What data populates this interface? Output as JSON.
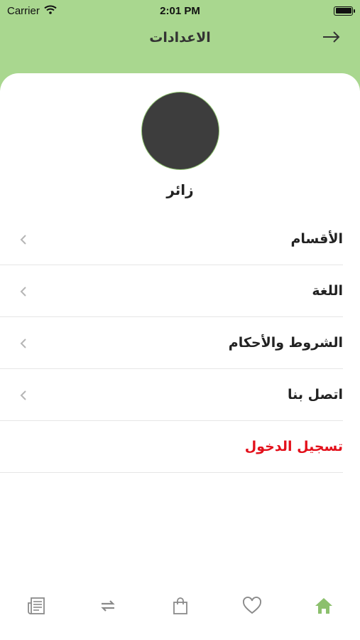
{
  "status_bar": {
    "carrier": "Carrier",
    "time": "2:01 PM"
  },
  "header": {
    "title": "الاعدادات"
  },
  "profile": {
    "name": "زائر"
  },
  "menu": {
    "items": [
      {
        "label": "الأقسام"
      },
      {
        "label": "اللغة"
      },
      {
        "label": "الشروط والأحكام"
      },
      {
        "label": "اتصل بنا"
      }
    ],
    "logout_label": "تسجيل الدخول"
  },
  "tabbar": {
    "tabs": [
      {
        "icon": "newspaper-icon",
        "active": false
      },
      {
        "icon": "exchange-icon",
        "active": false
      },
      {
        "icon": "shopping-bag-icon",
        "active": false
      },
      {
        "icon": "heart-icon",
        "active": false
      },
      {
        "icon": "home-icon",
        "active": true
      }
    ]
  },
  "colors": {
    "header_bg": "#a9d78f",
    "accent": "#8cc06d",
    "logout": "#e3101b",
    "inactive_icon": "#8a8a8a",
    "active_icon": "#8cc06d"
  }
}
